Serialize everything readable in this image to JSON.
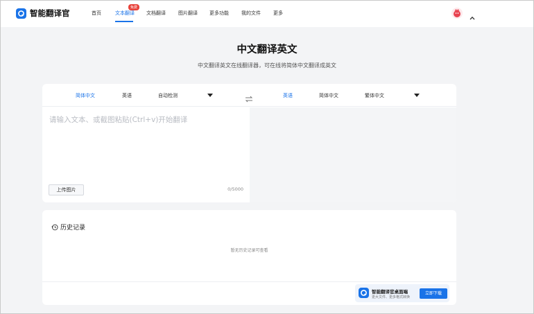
{
  "brand": {
    "name": "智能翻译官",
    "accent": "#1a73e8"
  },
  "nav": {
    "items": [
      {
        "label": "首页"
      },
      {
        "label": "文本翻译",
        "badge": "免费"
      },
      {
        "label": "文档翻译"
      },
      {
        "label": "图片翻译"
      },
      {
        "label": "更多功能"
      },
      {
        "label": "我的文件"
      },
      {
        "label": "更多"
      }
    ]
  },
  "page": {
    "title": "中文翻译英文",
    "subtitle": "中文翻译英文在线翻译器，可在线将简体中文翻译成英文"
  },
  "source_langs": [
    "简体中文",
    "英语",
    "自动检测"
  ],
  "target_langs": [
    "英语",
    "简体中文",
    "繁体中文"
  ],
  "input": {
    "placeholder": "请输入文本、或截图粘贴(Ctrl+v)开始翻译",
    "upload_label": "上传图片",
    "counter": "0/5000"
  },
  "history": {
    "title": "历史记录",
    "empty_text": "暂无历史记录可查看"
  },
  "promo": {
    "title": "智能翻译官桌面端",
    "subtitle": "更大文件、更多格式转换",
    "button": "立即下载"
  }
}
